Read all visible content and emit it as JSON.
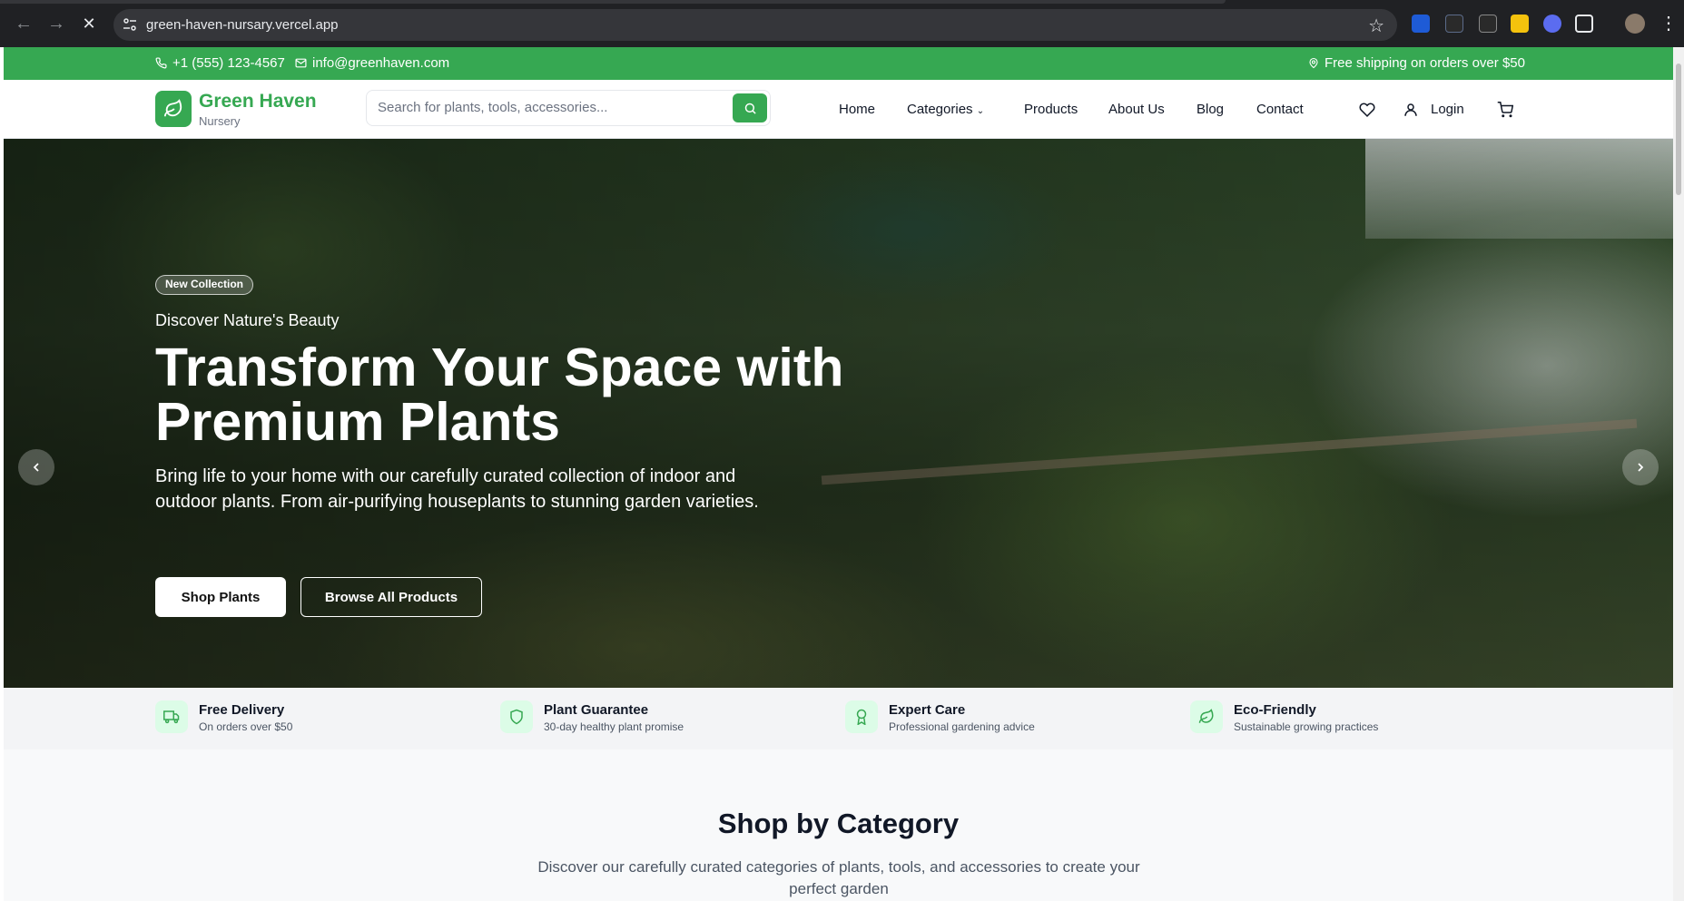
{
  "browser": {
    "url": "green-haven-nursary.vercel.app"
  },
  "topbar": {
    "phone": "+1 (555) 123-4567",
    "email": "info@greenhaven.com",
    "shipping": "Free shipping on orders over $50"
  },
  "header": {
    "brand": "Green Haven",
    "brand_sub": "Nursery",
    "search_placeholder": "Search for plants, tools, accessories...",
    "nav": {
      "home": "Home",
      "categories": "Categories",
      "products": "Products",
      "about": "About Us",
      "blog": "Blog",
      "contact": "Contact"
    },
    "login": "Login"
  },
  "hero": {
    "badge": "New Collection",
    "subtitle": "Discover Nature's Beauty",
    "title": "Transform Your Space with Premium Plants",
    "description": "Bring life to your home with our carefully curated collection of indoor and outdoor plants. From air-purifying houseplants to stunning garden varieties.",
    "primary_button": "Shop Plants",
    "secondary_button": "Browse All Products"
  },
  "features": [
    {
      "title": "Free Delivery",
      "desc": "On orders over $50",
      "icon": "truck-icon"
    },
    {
      "title": "Plant Guarantee",
      "desc": "30-day healthy plant promise",
      "icon": "shield-icon"
    },
    {
      "title": "Expert Care",
      "desc": "Professional gardening advice",
      "icon": "award-icon"
    },
    {
      "title": "Eco-Friendly",
      "desc": "Sustainable growing practices",
      "icon": "leaf-icon"
    }
  ],
  "section": {
    "title": "Shop by Category",
    "description": "Discover our carefully curated categories of plants, tools, and accessories to create your perfect garden"
  },
  "colors": {
    "brand": "#36a852",
    "chrome": "#202124"
  }
}
